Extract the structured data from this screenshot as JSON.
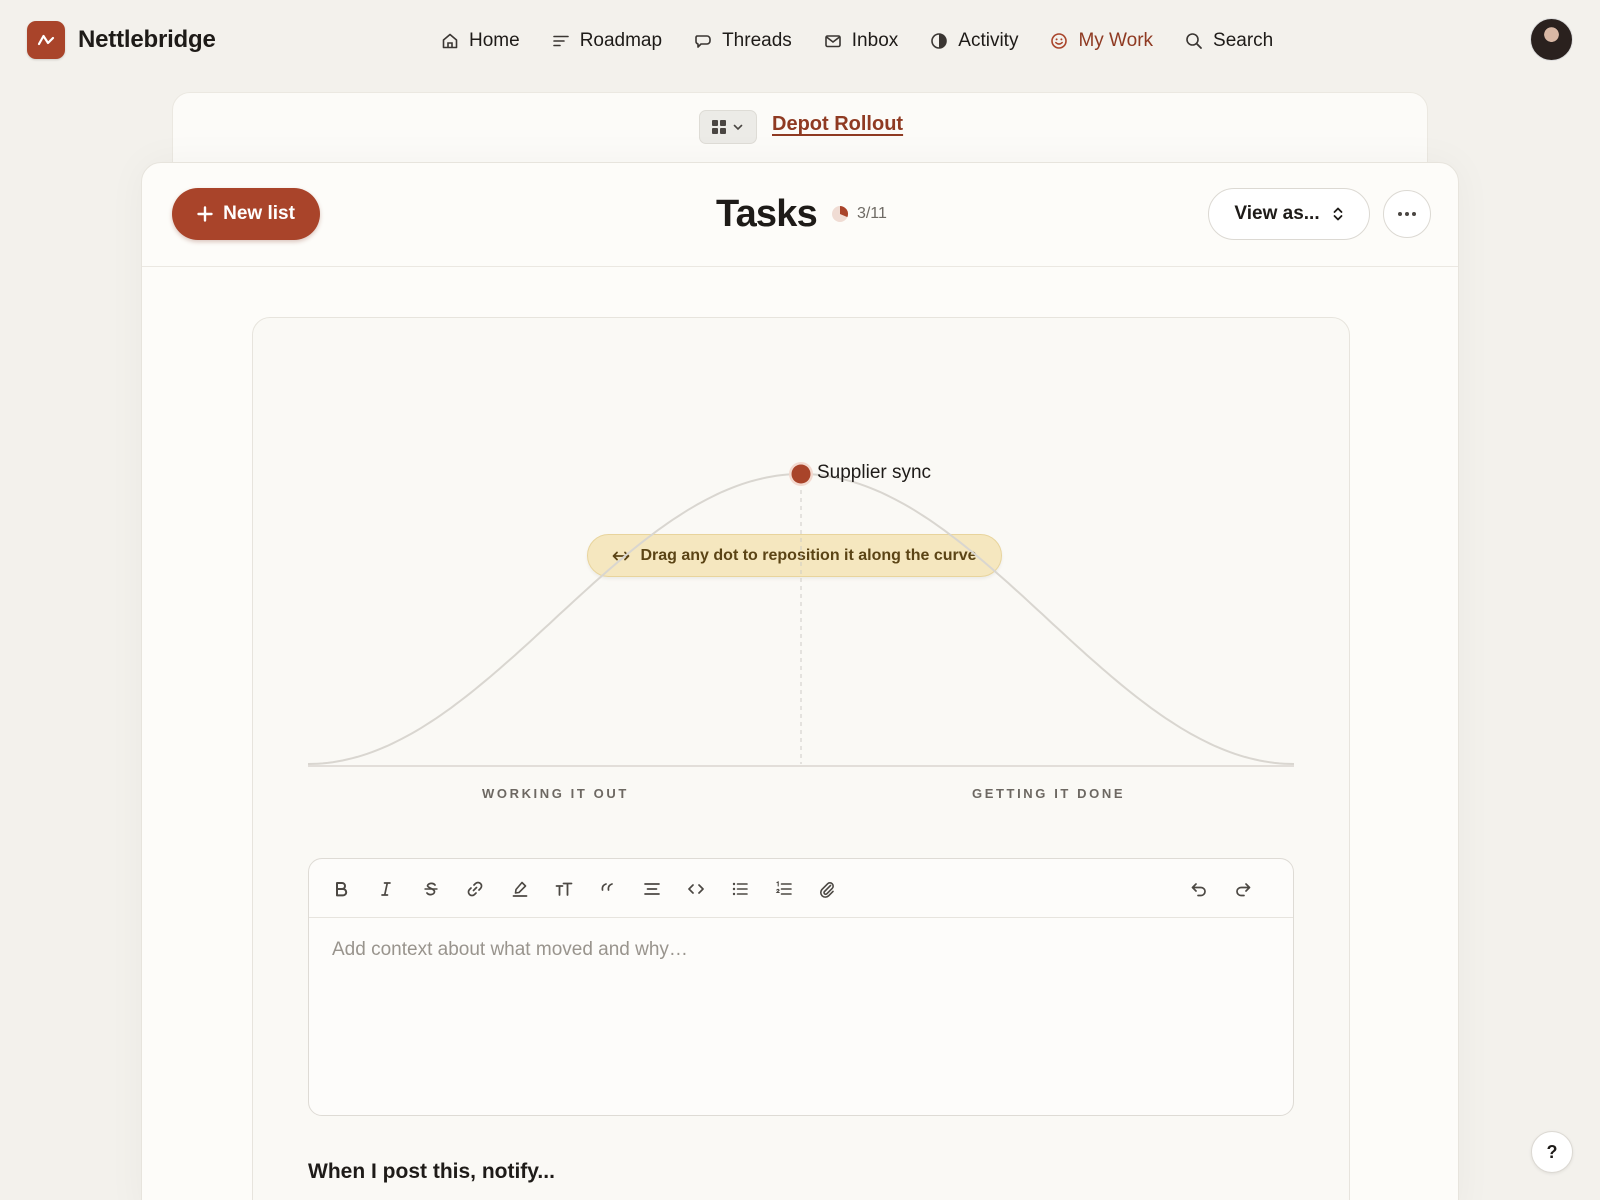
{
  "app": {
    "name": "Nettlebridge"
  },
  "nav": {
    "items": [
      {
        "label": "Home",
        "icon": "home-icon"
      },
      {
        "label": "Roadmap",
        "icon": "roadmap-icon"
      },
      {
        "label": "Threads",
        "icon": "chat-bubble-icon"
      },
      {
        "label": "Inbox",
        "icon": "envelope-icon"
      },
      {
        "label": "Activity",
        "icon": "half-circle-icon"
      },
      {
        "label": "My Work",
        "icon": "smiley-icon",
        "active": true
      },
      {
        "label": "Search",
        "icon": "search-icon"
      }
    ]
  },
  "project": {
    "name": "Depot Rollout"
  },
  "page": {
    "title": "Tasks",
    "progress": "3/11",
    "new_list_label": "New list",
    "view_as_label": "View as..."
  },
  "hill": {
    "hint": "Drag any dot to reposition it along the curve",
    "left_label": "WORKING IT OUT",
    "right_label": "GETTING IT DONE",
    "dots": [
      {
        "label": "Supplier sync",
        "position_pct": 50
      }
    ]
  },
  "editor": {
    "placeholder": "Add context about what moved and why…",
    "tools": [
      "bold",
      "italic",
      "strikethrough",
      "link",
      "highlight",
      "text-size",
      "quote",
      "align",
      "code",
      "bullet-list",
      "numbered-list",
      "attachment",
      "undo",
      "redo"
    ]
  },
  "notify": {
    "heading": "When I post this, notify..."
  },
  "help": {
    "label": "?"
  },
  "colors": {
    "accent": "#a9442a",
    "accent_text": "#8f3a22",
    "hint_bg": "#f5e7bf",
    "background": "#f3f1ec"
  }
}
